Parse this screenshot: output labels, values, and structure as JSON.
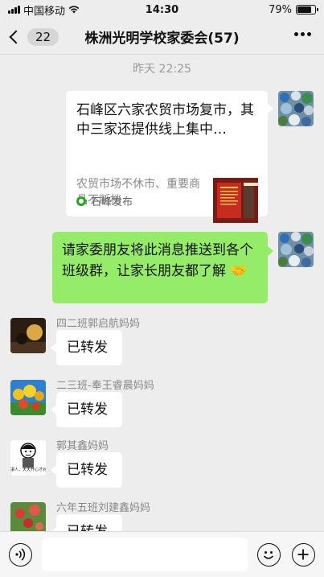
{
  "status_bar": {
    "carrier": "中国移动",
    "time": "14:30",
    "battery_text": "79%",
    "battery_level": 0.79
  },
  "nav": {
    "unread_count": "22",
    "title": "株洲光明学校家委会(57)"
  },
  "chat": {
    "timestamp": "昨天 22:25",
    "link_card": {
      "title": "石峰区六家农贸市场复市，其中三家还提供线上集中…",
      "description": "农贸市场不休市、重要商品不断档",
      "source": "石峰发布"
    },
    "outgoing_message": "请家委朋友将此消息推送到各个班级群，让家长朋友都了解",
    "incoming": [
      {
        "sender": "四二班郭启航妈妈",
        "text": "已转发"
      },
      {
        "sender": "二三班-奉王睿晨妈妈",
        "text": "已转发"
      },
      {
        "sender": "郭其鑫妈妈",
        "text": "已转发",
        "avatar_caption": "凄人，天天开心才对"
      },
      {
        "sender": "六年五班刘建鑫妈妈",
        "text": "已转发"
      }
    ]
  },
  "colors": {
    "outgoing_bubble": "#95ec69",
    "background": "#ededed",
    "source_icon": "#1aad19"
  },
  "icons": [
    "back-chevron-icon",
    "more-icon",
    "wifi-icon",
    "battery-icon",
    "voice-icon",
    "emoji-icon",
    "plus-icon",
    "handshake-emoji-icon"
  ]
}
